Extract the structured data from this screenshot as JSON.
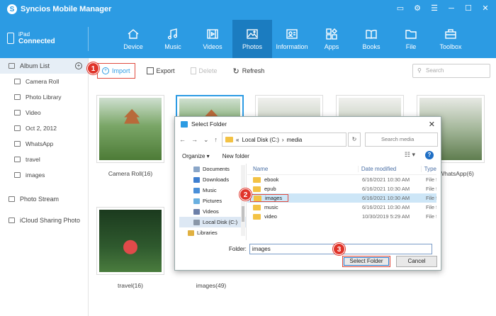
{
  "app": {
    "title": "Syncios Mobile Manager",
    "logo_glyph": "S"
  },
  "window_controls": [
    "▭",
    "⚙",
    "☰",
    "─",
    "☐",
    "✕"
  ],
  "device": {
    "name": "iPad",
    "status": "Connected"
  },
  "nav": [
    {
      "label": "Device",
      "icon": "home-icon"
    },
    {
      "label": "Music",
      "icon": "music-icon"
    },
    {
      "label": "Videos",
      "icon": "video-icon"
    },
    {
      "label": "Photos",
      "icon": "photo-icon"
    },
    {
      "label": "Information",
      "icon": "contact-card-icon"
    },
    {
      "label": "Apps",
      "icon": "apps-icon"
    },
    {
      "label": "Books",
      "icon": "book-icon"
    },
    {
      "label": "File",
      "icon": "folder-icon"
    },
    {
      "label": "Toolbox",
      "icon": "toolbox-icon"
    }
  ],
  "sidebar": {
    "album_list": "Album List",
    "add_glyph": "+",
    "albums": [
      "Camera Roll",
      "Photo Library",
      "Video",
      "Oct 2, 2012",
      "WhatsApp",
      "travel",
      "images"
    ],
    "photo_stream": "Photo Stream",
    "icloud": "iCloud Sharing Photo"
  },
  "toolbar": {
    "import": "Import",
    "export": "Export",
    "delete": "Delete",
    "refresh": "Refresh",
    "search_placeholder": "Search"
  },
  "albums_grid": {
    "camera_roll": "Camera Roll(16)",
    "whatsapp": "WhatsApp(6)",
    "travel": "travel(16)",
    "images": "images(49)"
  },
  "dialog": {
    "title": "Select Folder",
    "close": "✕",
    "nav_back": "←",
    "nav_fwd": "→",
    "nav_down": "⌄",
    "nav_up": "↑",
    "addr_prefix": "«",
    "addr_drive": "Local Disk (C:)",
    "addr_sep": "›",
    "addr_folder": "media",
    "refresh": "↻",
    "search_placeholder": "Search media",
    "organize": "Organize ▾",
    "new_folder": "New folder",
    "view": "☷ ▾",
    "help": "?",
    "nav_pane": [
      {
        "label": "Documents",
        "color": "#8aa6c8"
      },
      {
        "label": "Downloads",
        "color": "#3f7fd0"
      },
      {
        "label": "Music",
        "color": "#4a8fd8"
      },
      {
        "label": "Pictures",
        "color": "#6ab0e0"
      },
      {
        "label": "Videos",
        "color": "#6c7fa8"
      },
      {
        "label": "Local Disk (C:)",
        "color": "#8a97a8"
      },
      {
        "label": "Libraries",
        "color": "#e0b040"
      }
    ],
    "columns": {
      "name": "Name",
      "date": "Date modified",
      "type": "Type"
    },
    "files": [
      {
        "name": "ebook",
        "date": "6/16/2021 10:30 AM",
        "type": "File fo"
      },
      {
        "name": "epub",
        "date": "6/16/2021 10:30 AM",
        "type": "File fo"
      },
      {
        "name": "images",
        "date": "6/16/2021 10:30 AM",
        "type": "File fo"
      },
      {
        "name": "music",
        "date": "6/16/2021 10:30 AM",
        "type": "File fo"
      },
      {
        "name": "video",
        "date": "10/30/2019 5:29 AM",
        "type": "File fo"
      }
    ],
    "folder_label": "Folder:",
    "folder_value": "images",
    "select_btn": "Select Folder",
    "cancel_btn": "Cancel"
  },
  "badges": [
    "1",
    "2",
    "3"
  ],
  "colors": {
    "header": "#2c9be3",
    "active_nav": "#1b7cc0",
    "callout": "#e0342a"
  }
}
